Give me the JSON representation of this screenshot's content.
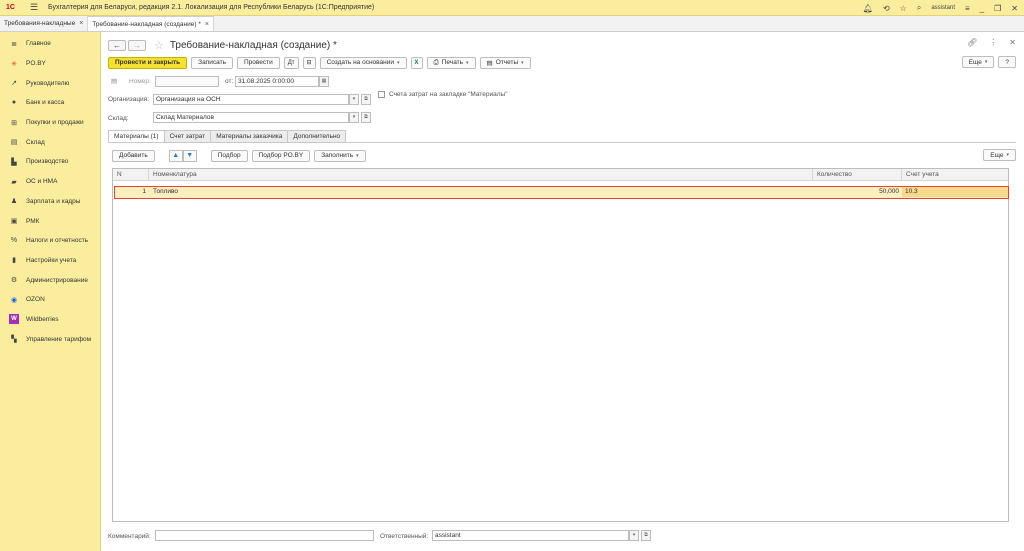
{
  "app": {
    "logo_text": "1С",
    "title": "Бухгалтерия для Беларуси, редакция 2.1. Локализация для Республики Беларусь   (1С:Предприятие)",
    "user": "assistant"
  },
  "window_tabs": [
    {
      "label": "Требования-накладные"
    },
    {
      "label": "Требование-накладная (создание) *"
    }
  ],
  "sidebar": {
    "items": [
      {
        "label": "Главное",
        "icon": "menu-lines-icon"
      },
      {
        "label": "PO.BY",
        "icon": "star-icon"
      },
      {
        "label": "Руководителю",
        "icon": "trend-icon"
      },
      {
        "label": "Банк и касса",
        "icon": "bank-icon"
      },
      {
        "label": "Покупки и продажи",
        "icon": "cart-icon"
      },
      {
        "label": "Склад",
        "icon": "warehouse-icon"
      },
      {
        "label": "Производство",
        "icon": "factory-icon"
      },
      {
        "label": "ОС и НМА",
        "icon": "truck-icon"
      },
      {
        "label": "Зарплата и кадры",
        "icon": "person-icon"
      },
      {
        "label": "РМК",
        "icon": "register-icon"
      },
      {
        "label": "Налоги и отчетность",
        "icon": "percent-icon"
      },
      {
        "label": "Настройки учета",
        "icon": "book-icon"
      },
      {
        "label": "Администрирование",
        "icon": "gear-icon"
      },
      {
        "label": "OZON",
        "icon": "ozon-icon"
      },
      {
        "label": "Wildberries",
        "icon": "wildberries-icon"
      },
      {
        "label": "Управление тарифом",
        "icon": "tariff-icon"
      }
    ]
  },
  "document": {
    "title": "Требование-накладная (создание) *",
    "toolbar": {
      "post_close": "Провести и закрыть",
      "save": "Записать",
      "post": "Провести",
      "create_based": "Создать на основании",
      "print": "Печать",
      "reports": "Отчеты",
      "more": "Еще",
      "help": "?"
    },
    "number_label": "Номер:",
    "number_value": "",
    "date_label": "от:",
    "date_value": "31.08.2025  0:00:00",
    "org_label": "Организация:",
    "org_value": "Организация на ОСН",
    "warehouse_label": "Склад:",
    "warehouse_value": "Склад Материалов",
    "checkbox_label": "Счета затрат на закладке \"Материалы\"",
    "tabs": [
      {
        "label": "Материалы (1)"
      },
      {
        "label": "Счет затрат"
      },
      {
        "label": "Материалы заказчика"
      },
      {
        "label": "Дополнительно"
      }
    ],
    "table_toolbar": {
      "add": "Добавить",
      "pick": "Подбор",
      "pick_poby": "Подбор PO.BY",
      "fill": "Заполнить",
      "more": "Еще"
    },
    "columns": {
      "n": "N",
      "item": "Номенклатура",
      "qty": "Количество",
      "account": "Счет учета"
    },
    "rows": [
      {
        "n": "1",
        "item": "Топливо",
        "qty": "50,000",
        "account": "10.3"
      }
    ],
    "comment_label": "Комментарий:",
    "comment_value": "",
    "responsible_label": "Ответственный:",
    "responsible_value": "assistant"
  }
}
